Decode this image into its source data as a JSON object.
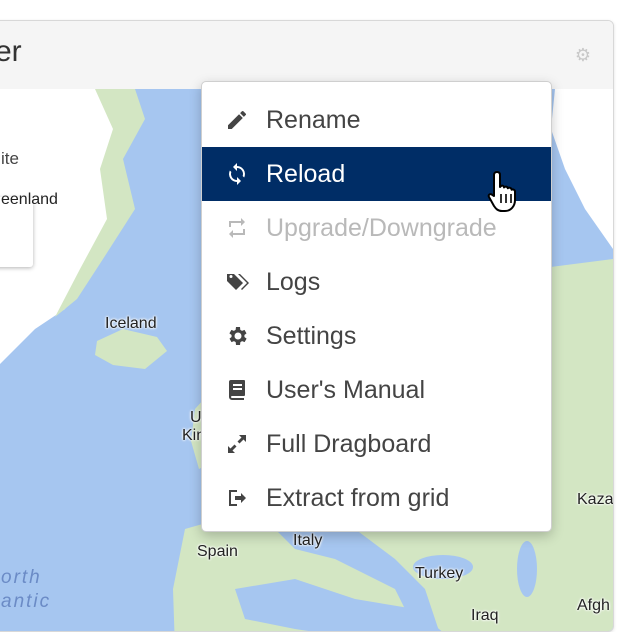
{
  "widget": {
    "title": "er"
  },
  "map": {
    "map_type_label": "ite",
    "labels": {
      "greenland": "eenland",
      "iceland": "Iceland",
      "uk_line1": "U",
      "uk_line2": "Kin",
      "spain": "Spain",
      "italy": "Italy",
      "turkey": "Turkey",
      "iraq": "Iraq",
      "kazakhstan": "Kaza",
      "afghanistan": "Afgh",
      "ocean_line1": "orth",
      "ocean_line2": "antic"
    },
    "colors": {
      "ocean": "#a6c6f0",
      "land": "#d3e6c3",
      "ice": "#ffffff",
      "land_dark": "#c2dbb0"
    }
  },
  "menu": {
    "items": [
      {
        "label": "Rename",
        "icon": "pencil-icon",
        "state": "normal"
      },
      {
        "label": "Reload",
        "icon": "refresh-icon",
        "state": "active"
      },
      {
        "label": "Upgrade/Downgrade",
        "icon": "retweet-icon",
        "state": "disabled"
      },
      {
        "label": "Logs",
        "icon": "tags-icon",
        "state": "normal"
      },
      {
        "label": "Settings",
        "icon": "gear-icon",
        "state": "normal"
      },
      {
        "label": "User's Manual",
        "icon": "book-icon",
        "state": "normal"
      },
      {
        "label": "Full Dragboard",
        "icon": "expand-icon",
        "state": "normal"
      },
      {
        "label": "Extract from grid",
        "icon": "sign-out-icon",
        "state": "normal"
      }
    ],
    "active_color": "#002d66"
  }
}
